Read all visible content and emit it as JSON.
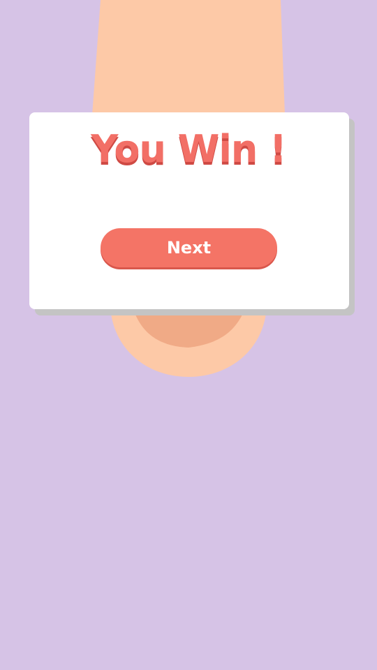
{
  "dialog": {
    "title": "You Win !",
    "next_label": "Next"
  },
  "colors": {
    "background": "#d6c3e6",
    "skin": "#fdc9a7",
    "nail": "#f0aa86",
    "accent": "#f47466",
    "dialog": "#ffffff"
  }
}
